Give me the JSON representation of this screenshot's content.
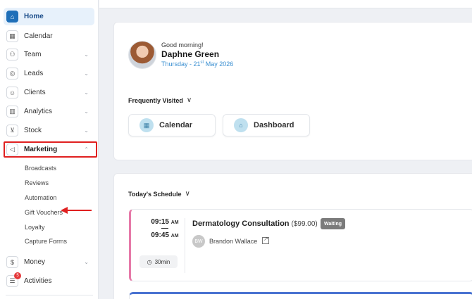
{
  "sidebar": {
    "items": [
      {
        "label": "Home",
        "icon": "home-icon"
      },
      {
        "label": "Calendar",
        "icon": "calendar-icon"
      },
      {
        "label": "Team",
        "icon": "team-icon"
      },
      {
        "label": "Leads",
        "icon": "target-icon"
      },
      {
        "label": "Clients",
        "icon": "user-icon"
      },
      {
        "label": "Analytics",
        "icon": "bar-chart-icon"
      },
      {
        "label": "Stock",
        "icon": "cart-icon"
      },
      {
        "label": "Marketing",
        "icon": "megaphone-icon"
      },
      {
        "label": "Money",
        "icon": "dollar-icon"
      },
      {
        "label": "Activities",
        "icon": "activities-icon",
        "badge": "5"
      }
    ],
    "marketing_sub": [
      "Broadcasts",
      "Reviews",
      "Automation",
      "Gift Vouchers",
      "Loyalty",
      "Capture Forms"
    ]
  },
  "header": {
    "greeting": "Good morning!",
    "user_name": "Daphne Green",
    "date_prefix": "Thursday - 21",
    "date_sup": "st",
    "date_suffix": " May 2026"
  },
  "frequently_visited": {
    "title": "Frequently Visited",
    "items": [
      {
        "label": "Calendar",
        "icon": "calendar-icon"
      },
      {
        "label": "Dashboard",
        "icon": "home-icon"
      }
    ]
  },
  "schedule": {
    "title": "Today's Schedule",
    "appointments": [
      {
        "start": "09:15",
        "start_ampm": "AM",
        "end": "09:45",
        "end_ampm": "AM",
        "duration": "30min",
        "service": "Dermatology Consultation",
        "price": "($99.00)",
        "status": "Waiting",
        "client_initials": "BW",
        "client_name": "Brandon Wallace"
      }
    ]
  },
  "colors": {
    "accent": "#1f6fb8",
    "highlight": "#e02020",
    "appt_border": "#e679a8",
    "status_bg": "#7b7b7b"
  }
}
